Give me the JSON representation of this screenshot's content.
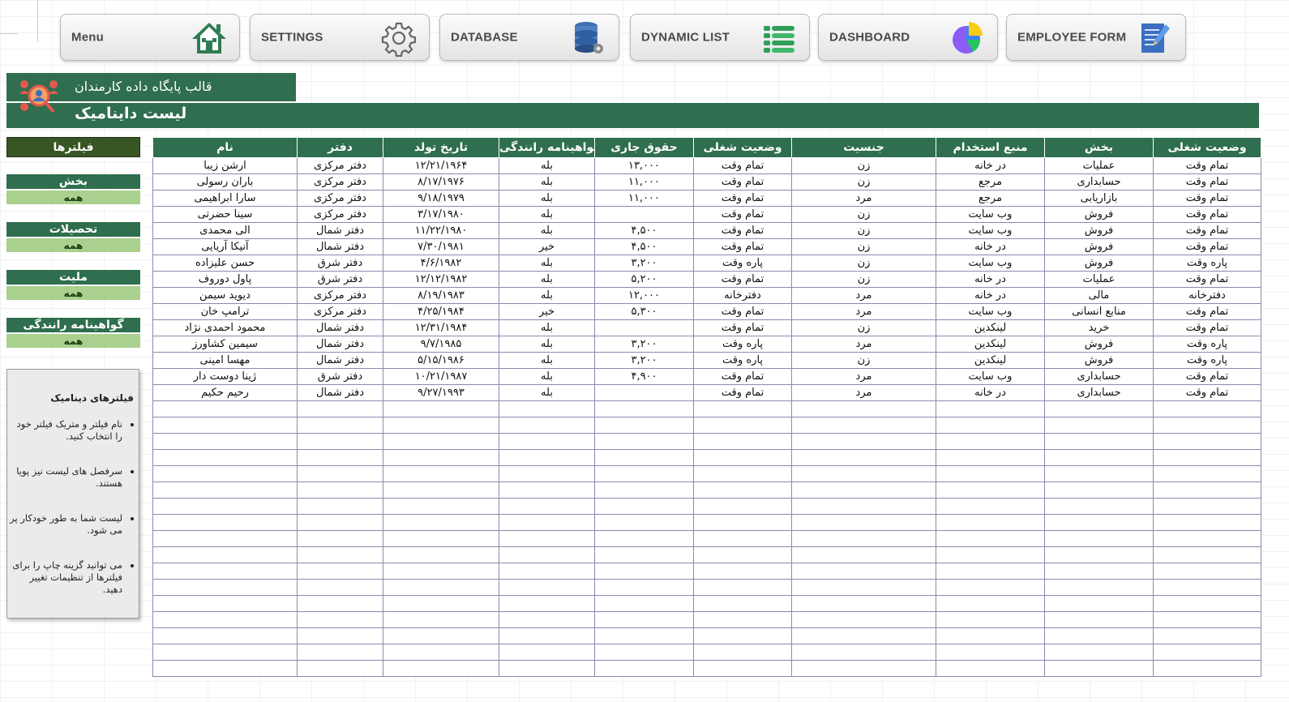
{
  "nav": [
    {
      "label": "Menu",
      "icon": "house-icon"
    },
    {
      "label": "SETTINGS",
      "icon": "gear-icon"
    },
    {
      "label": "DATABASE",
      "icon": "database-icon"
    },
    {
      "label": "DYNAMIC LIST",
      "icon": "list-icon"
    },
    {
      "label": "DASHBOARD",
      "icon": "pie-chart-icon"
    },
    {
      "label": "EMPLOYEE FORM",
      "icon": "form-icon"
    }
  ],
  "header": {
    "subtitle": "قالب پایگاه داده کارمندان",
    "title": "لیست داینامیک"
  },
  "filters": {
    "title": "فیلترها",
    "items": [
      {
        "label": "بخش",
        "value": "همه"
      },
      {
        "label": "تحصیلات",
        "value": "همه"
      },
      {
        "label": "ملیت",
        "value": "همه"
      },
      {
        "label": "گواهینامه رانندگی",
        "value": "همه"
      }
    ]
  },
  "info": {
    "title": "فیلترهای دینامیک",
    "bullets": [
      "نام فیلتر و متریک فیلتر خود را انتخاب کنید.",
      "سرفصل های لیست نیز پویا هستند.",
      "لیست شما به طور خودکار پر می شود.",
      "می توانید گزینه چاپ را برای فیلترها از تنظیمات تغییر دهید."
    ]
  },
  "table": {
    "columns": [
      "نام",
      "دفتر",
      "تاریخ تولد",
      "گواهینامه رانندگی",
      "حقوق جاری",
      "وضعیت شغلی",
      "جنسیت",
      "منبع استخدام",
      "بخش",
      "وضعیت شغلی"
    ],
    "rows": [
      [
        "ارشن زیبا",
        "دفتر مرکزی",
        "۱۲/۲۱/۱۹۶۴",
        "بله",
        "۱۳,۰۰۰",
        "تمام وقت",
        "زن",
        "در خانه",
        "عملیات",
        "تمام وقت"
      ],
      [
        "باران رسولی",
        "دفتر مرکزی",
        "۸/۱۷/۱۹۷۶",
        "بله",
        "۱۱,۰۰۰",
        "تمام وقت",
        "زن",
        "مرجع",
        "حسابداری",
        "تمام وقت"
      ],
      [
        "سارا ابراهیمی",
        "دفتر مرکزی",
        "۹/۱۸/۱۹۷۹",
        "بله",
        "۱۱,۰۰۰",
        "تمام وقت",
        "مرد",
        "مرجع",
        "بازاریابی",
        "تمام وقت"
      ],
      [
        "سینا حضرتی",
        "دفتر مرکزی",
        "۳/۱۷/۱۹۸۰",
        "بله",
        "",
        "تمام وقت",
        "زن",
        "وب سایت",
        "فروش",
        "تمام وقت"
      ],
      [
        "الی محمدی",
        "دفتر شمال",
        "۱۱/۲۲/۱۹۸۰",
        "بله",
        "۴,۵۰۰",
        "تمام وقت",
        "زن",
        "وب سایت",
        "فروش",
        "تمام وقت"
      ],
      [
        "آنیکا آریایی",
        "دفتر شمال",
        "۷/۳۰/۱۹۸۱",
        "خیر",
        "۴,۵۰۰",
        "تمام وقت",
        "زن",
        "در خانه",
        "فروش",
        "تمام وقت"
      ],
      [
        "حسن علیزاده",
        "دفتر شرق",
        "۴/۶/۱۹۸۲",
        "بله",
        "۳,۲۰۰",
        "پاره وقت",
        "زن",
        "وب سایت",
        "فروش",
        "پاره وقت"
      ],
      [
        "پاول دوروف",
        "دفتر شرق",
        "۱۲/۱۲/۱۹۸۲",
        "بله",
        "۵,۲۰۰",
        "تمام وقت",
        "زن",
        "در خانه",
        "عملیات",
        "تمام وقت"
      ],
      [
        "دیوید سیمن",
        "دفتر مرکزی",
        "۸/۱۹/۱۹۸۳",
        "بله",
        "۱۲,۰۰۰",
        "دفترخانه",
        "مرد",
        "در خانه",
        "مالی",
        "دفترخانه"
      ],
      [
        "ترامپ خان",
        "دفتر مرکزی",
        "۴/۲۵/۱۹۸۴",
        "خیر",
        "۵,۳۰۰",
        "تمام وقت",
        "مرد",
        "وب سایت",
        "منابع انسانی",
        "تمام وقت"
      ],
      [
        "محمود احمدی نژاد",
        "دفتر شمال",
        "۱۲/۳۱/۱۹۸۴",
        "بله",
        "",
        "تمام وقت",
        "زن",
        "لینکدین",
        "خرید",
        "تمام وقت"
      ],
      [
        "سیمین کشاورز",
        "دفتر شمال",
        "۹/۷/۱۹۸۵",
        "بله",
        "۳,۲۰۰",
        "پاره وقت",
        "مرد",
        "لینکدین",
        "فروش",
        "پاره وقت"
      ],
      [
        "مهسا امینی",
        "دفتر شمال",
        "۵/۱۵/۱۹۸۶",
        "بله",
        "۳,۲۰۰",
        "پاره وقت",
        "زن",
        "لینکدین",
        "فروش",
        "پاره وقت"
      ],
      [
        "ژینا دوست دار",
        "دفتر شرق",
        "۱۰/۲۱/۱۹۸۷",
        "بله",
        "۴,۹۰۰",
        "تمام وقت",
        "مرد",
        "وب سایت",
        "حسابداری",
        "تمام وقت"
      ],
      [
        "رحیم حکیم",
        "دفتر شمال",
        "۹/۲۷/۱۹۹۳",
        "بله",
        "",
        "تمام وقت",
        "مرد",
        "در خانه",
        "حسابداری",
        "تمام وقت"
      ]
    ]
  }
}
